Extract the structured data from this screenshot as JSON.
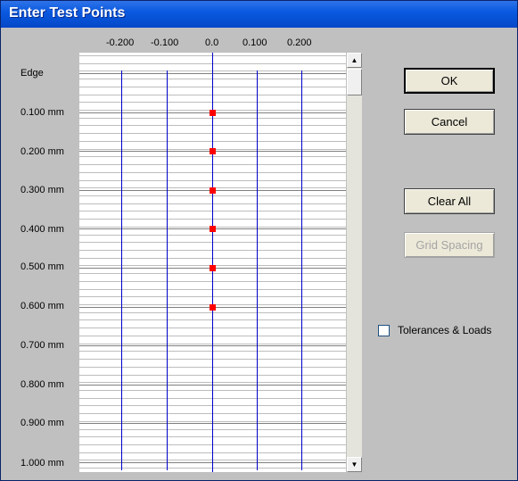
{
  "window": {
    "title": "Enter Test Points"
  },
  "columns": [
    "-0.200",
    "-0.100",
    "0.0",
    "0.100",
    "0.200"
  ],
  "rows": [
    "Edge",
    "0.100 mm",
    "0.200 mm",
    "0.300 mm",
    "0.400 mm",
    "0.500 mm",
    "0.600 mm",
    "0.700 mm",
    "0.800 mm",
    "0.900 mm",
    "1.000 mm"
  ],
  "buttons": {
    "ok": "OK",
    "cancel": "Cancel",
    "clear_all": "Clear All",
    "grid_spacing": "Grid Spacing"
  },
  "checkbox": {
    "label": "Tolerances & Loads",
    "checked": false
  },
  "test_points": [
    {
      "x": 0.0,
      "y": "0.100 mm"
    },
    {
      "x": 0.0,
      "y": "0.200 mm"
    },
    {
      "x": 0.0,
      "y": "0.300 mm"
    },
    {
      "x": 0.0,
      "y": "0.400 mm"
    },
    {
      "x": 0.0,
      "y": "0.500 mm"
    },
    {
      "x": 0.0,
      "y": "0.600 mm"
    }
  ],
  "colors": {
    "title_bar": "#0a5ae0",
    "grid_line": "#0000cc",
    "point": "#ff0000",
    "dialog": "#c0c0c0"
  }
}
